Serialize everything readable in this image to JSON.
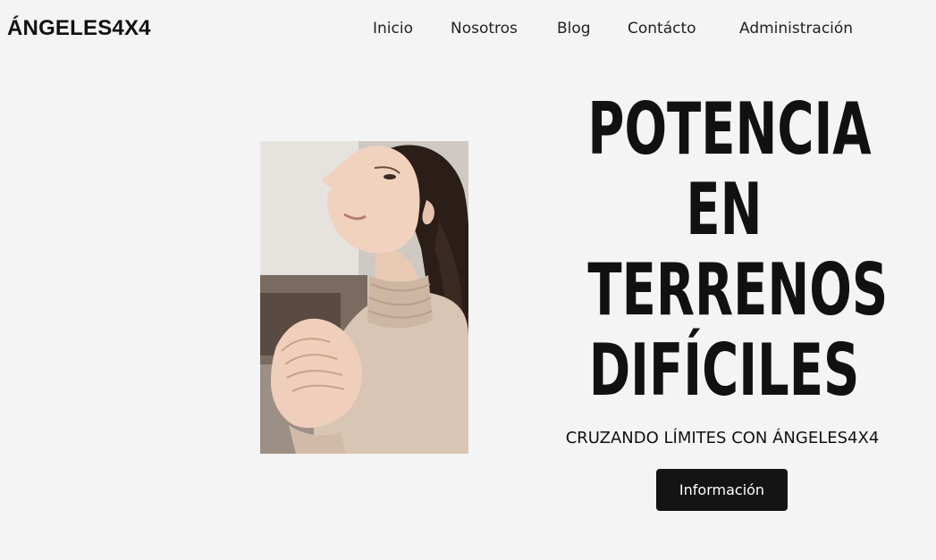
{
  "header": {
    "brand": "ÁNGELES4X4",
    "nav": [
      "Inicio",
      "Nosotros",
      "Blog",
      "Contácto",
      "Administración"
    ]
  },
  "hero": {
    "headline_lines": [
      "POTENCIA",
      "EN",
      "TERRENOS",
      "DIFÍCILES"
    ],
    "subtitle": "CRUZANDO LÍMITES CON ÁNGELES4X4",
    "cta_label": "Información",
    "image_subject": "woman-praying-photo"
  },
  "colors": {
    "background": "#f4f4f4",
    "text": "#111111",
    "button_bg": "#141414",
    "button_text": "#ffffff"
  }
}
